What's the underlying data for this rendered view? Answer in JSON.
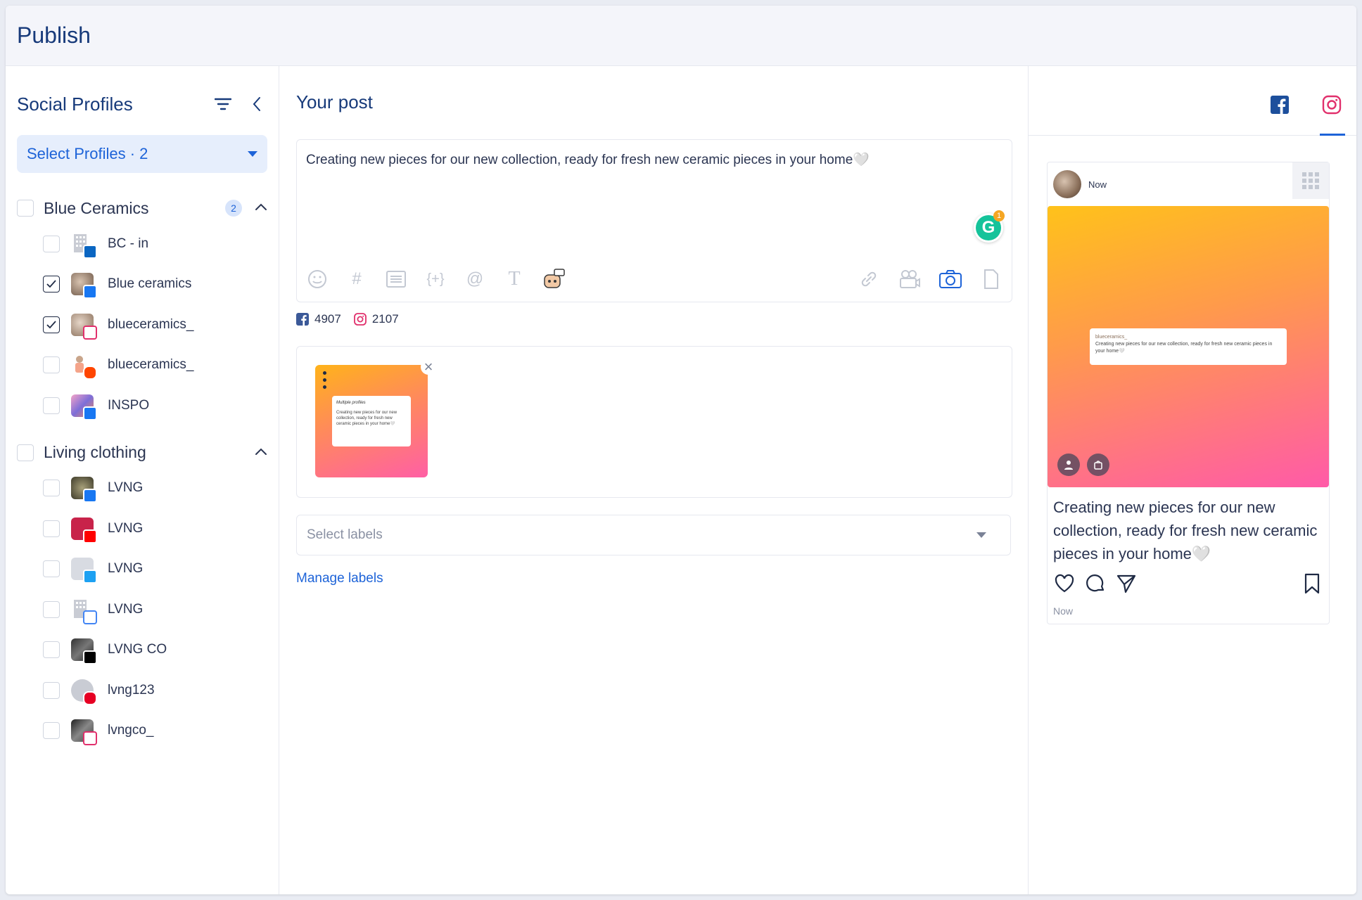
{
  "header": {
    "title": "Publish"
  },
  "sidebar": {
    "title": "Social Profiles",
    "select_label": "Select Profiles · 2",
    "groups": [
      {
        "name": "Blue Ceramics",
        "count": "2",
        "profiles": [
          {
            "name": "BC - in",
            "checked": false,
            "network": "linkedin"
          },
          {
            "name": "Blue ceramics",
            "checked": true,
            "network": "facebook"
          },
          {
            "name": "blueceramics_",
            "checked": true,
            "network": "instagram"
          },
          {
            "name": "blueceramics_",
            "checked": false,
            "network": "reddit"
          },
          {
            "name": "INSPO",
            "checked": false,
            "network": "facebook"
          }
        ]
      },
      {
        "name": "Living clothing",
        "profiles": [
          {
            "name": "LVNG",
            "checked": false,
            "network": "facebook"
          },
          {
            "name": "LVNG",
            "checked": false,
            "network": "youtube"
          },
          {
            "name": "LVNG",
            "checked": false,
            "network": "twitter"
          },
          {
            "name": "LVNG",
            "checked": false,
            "network": "google"
          },
          {
            "name": "LVNG CO",
            "checked": false,
            "network": "tiktok"
          },
          {
            "name": "lvng123",
            "checked": false,
            "network": "pinterest"
          },
          {
            "name": "lvngco_",
            "checked": false,
            "network": "instagram"
          }
        ]
      }
    ]
  },
  "post": {
    "title": "Your post",
    "text": "Creating new pieces for our new collection, ready for fresh new ceramic pieces in your home🤍",
    "grammarly_count": "1",
    "facebook_count": "4907",
    "instagram_count": "2107",
    "thumb_card_header": "Multiple profiles",
    "thumb_card_text": "Creating new pieces for our new collection, ready for fresh new ceramic pieces in your home🤍",
    "labels_placeholder": "Select labels",
    "manage_labels": "Manage labels"
  },
  "preview": {
    "time_top": "Now",
    "mini_user": "blueceramics_",
    "mini_text": "Creating new pieces for our new collection, ready for fresh new ceramic pieces in your home🤍",
    "caption": "Creating new pieces for our new collection, ready for fresh new ceramic pieces in your home🤍",
    "time_bottom": "Now"
  },
  "colors": {
    "accent": "#1d63d8",
    "facebook": "#1877f2",
    "instagram": "#e1306c"
  }
}
